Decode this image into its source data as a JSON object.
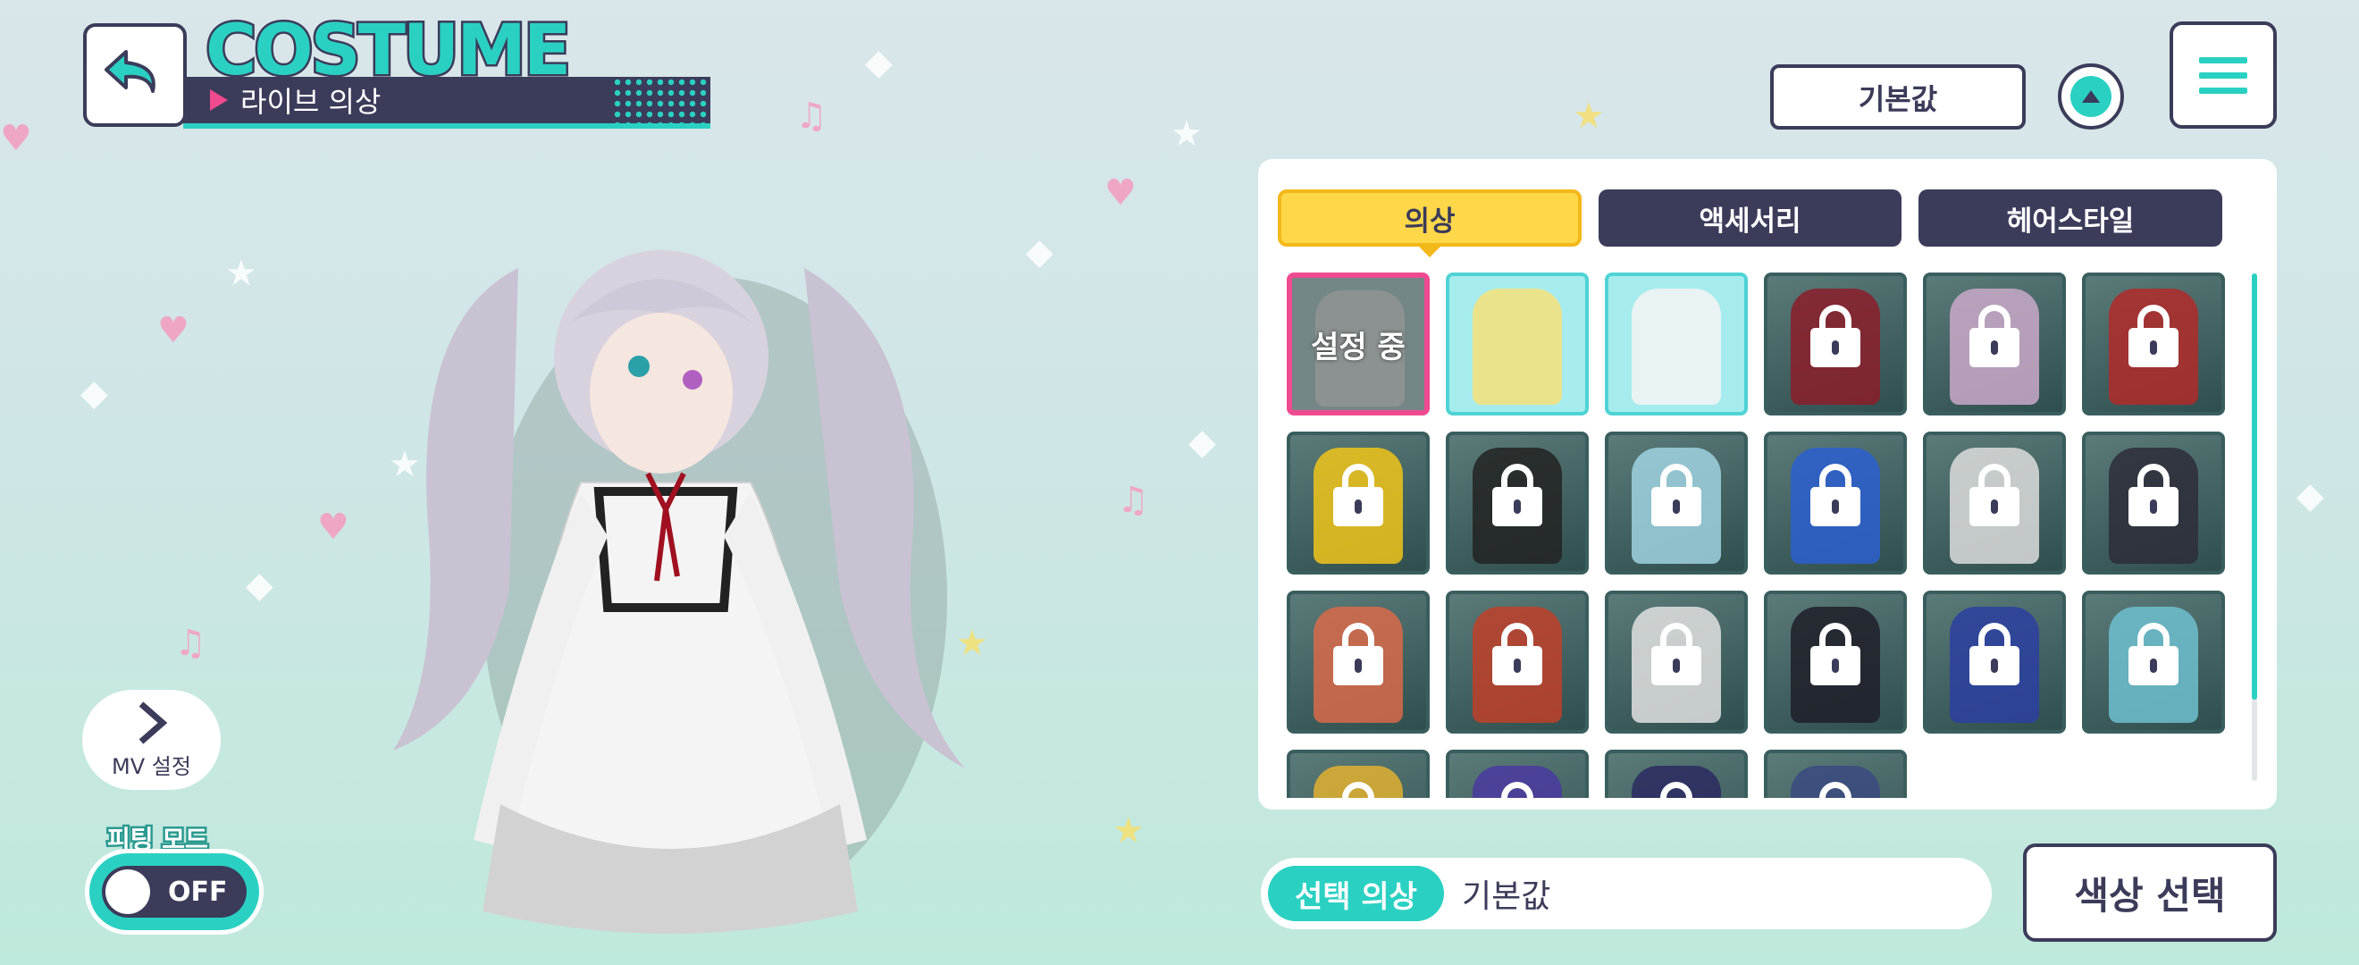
{
  "header": {
    "title": "COSTUME",
    "subtitle": "라이브 의상"
  },
  "top_right": {
    "default_label": "기본값"
  },
  "left_controls": {
    "mv_label": "MV 설정",
    "fitting_mode_label": "피팅 모드",
    "fitting_mode_state": "OFF"
  },
  "tabs": [
    {
      "label": "의상",
      "active": true
    },
    {
      "label": "액세서리",
      "active": false
    },
    {
      "label": "헤어스타일",
      "active": false
    }
  ],
  "costumes": [
    {
      "state": "selected",
      "label": "설정 중",
      "color": "#b9b9b9"
    },
    {
      "state": "unlocked",
      "color": "#f7e27a"
    },
    {
      "state": "unlocked",
      "color": "#f4f4f4"
    },
    {
      "state": "locked",
      "color": "#8b1d2a"
    },
    {
      "state": "locked",
      "color": "#c9a9c9"
    },
    {
      "state": "locked",
      "color": "#b22a2a"
    },
    {
      "state": "locked",
      "color": "#f0c419"
    },
    {
      "state": "locked",
      "color": "#222222"
    },
    {
      "state": "locked",
      "color": "#9fd2e0"
    },
    {
      "state": "locked",
      "color": "#2b5fd0"
    },
    {
      "state": "locked",
      "color": "#dcdcdc"
    },
    {
      "state": "locked",
      "color": "#2d2d3a"
    },
    {
      "state": "locked",
      "color": "#d86a4a"
    },
    {
      "state": "locked",
      "color": "#c0402a"
    },
    {
      "state": "locked",
      "color": "#e0e0e0"
    },
    {
      "state": "locked",
      "color": "#1e1e28"
    },
    {
      "state": "locked",
      "color": "#2b3fa0"
    },
    {
      "state": "locked",
      "color": "#6fc0d0"
    },
    {
      "state": "locked",
      "color": "#e0b030"
    },
    {
      "state": "locked",
      "color": "#4a3aa0"
    },
    {
      "state": "locked",
      "color": "#2a2a60"
    },
    {
      "state": "locked",
      "color": "#3a4a80"
    }
  ],
  "scroll": {
    "position_fraction": 0.0,
    "visible_fraction": 0.84
  },
  "selection": {
    "label": "선택 의상",
    "value": "기본값"
  },
  "color_select_label": "색상 선택",
  "colors": {
    "accent": "#2ad1c2",
    "dark": "#3b3b5a",
    "pink": "#f04a90",
    "tab_active": "#ffd84a"
  }
}
